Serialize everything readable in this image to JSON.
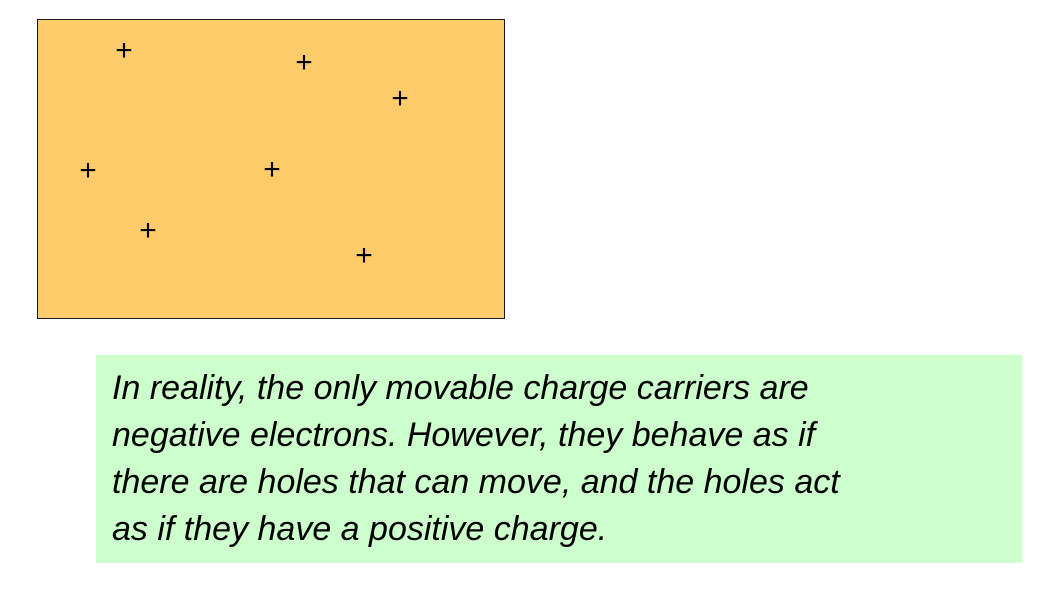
{
  "colors": {
    "material_fill": "#FDCB6A",
    "note_fill": "#CCFFCC",
    "charge_color": "#000000"
  },
  "diagram": {
    "charge_symbol": "+",
    "charge_count": 7
  },
  "note": {
    "lines": [
      "In reality, the only movable charge carriers are",
      "negative electrons.  However, they behave as if",
      "there are holes that can move, and the holes act",
      "as if they have a positive charge."
    ]
  }
}
